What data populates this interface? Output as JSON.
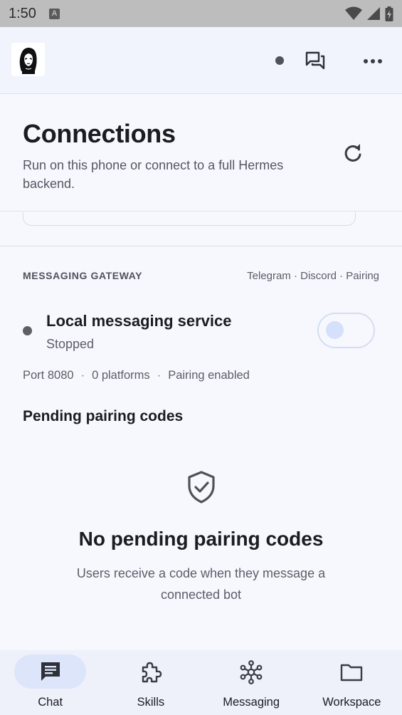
{
  "status_bar": {
    "time": "1:50",
    "notif_letter": "A"
  },
  "header": {
    "title": "Connections",
    "subtitle": "Run on this phone or connect to a full Hermes backend."
  },
  "gateway": {
    "section_label": "MESSAGING GATEWAY",
    "tags": "Telegram · Discord · Pairing",
    "service_title": "Local messaging service",
    "service_status": "Stopped",
    "toggle_on": false,
    "meta": {
      "port": "Port 8080",
      "platforms": "0 platforms",
      "pairing": "Pairing enabled",
      "separator": "·"
    }
  },
  "pending": {
    "title": "Pending pairing codes",
    "empty_title": "No pending pairing codes",
    "empty_desc": "Users receive a code when they message a connected bot"
  },
  "nav": {
    "items": [
      {
        "label": "Chat",
        "icon": "chat-icon",
        "active": true
      },
      {
        "label": "Skills",
        "icon": "puzzle-icon",
        "active": false
      },
      {
        "label": "Messaging",
        "icon": "hub-icon",
        "active": false
      },
      {
        "label": "Workspace",
        "icon": "folder-icon",
        "active": false
      }
    ]
  },
  "colors": {
    "accent_pill": "#dde5fa",
    "background": "#f7f8fe",
    "text_primary": "#1b1c22",
    "text_secondary": "#5b5e68"
  }
}
